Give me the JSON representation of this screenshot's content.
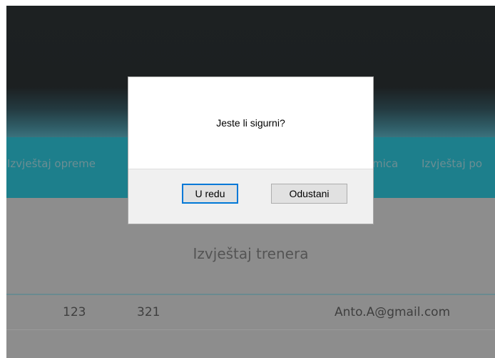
{
  "nav": {
    "items": [
      {
        "label": "Izvještaj opreme"
      },
      {
        "label": "mica"
      },
      {
        "label": "Izvještaj po"
      }
    ]
  },
  "report": {
    "title": "Izvještaj trenera",
    "row": {
      "col1": "123",
      "col2": "321",
      "email": "Anto.A@gmail.com"
    }
  },
  "dialog": {
    "message": "Jeste li sigurni?",
    "ok_label": "U redu",
    "cancel_label": "Odustani"
  },
  "colors": {
    "nav_background": "#1d7f8c",
    "header_background": "#1c2021",
    "overlay_background": "#8d8d8d",
    "primary_button_border": "#0078d7"
  }
}
